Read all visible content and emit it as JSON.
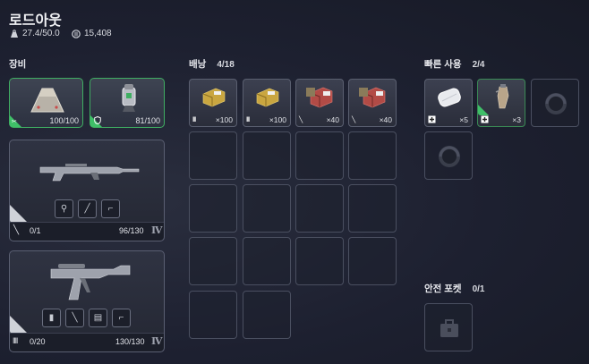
{
  "header": {
    "title": "로드아웃",
    "weight": "27.4/50.0",
    "currency": "15,408"
  },
  "equipment": {
    "label": "장비",
    "augment": {
      "value": "100/100"
    },
    "shield": {
      "value": "81/100"
    }
  },
  "weapons": [
    {
      "ammo": "0/1",
      "durability": "96/130",
      "tier": "Ⅳ",
      "attachments": [
        "scope-icon",
        "muzzle-icon",
        "stock-icon"
      ]
    },
    {
      "ammo": "0/20",
      "durability": "130/130",
      "tier": "Ⅳ",
      "attachments": [
        "grip-icon",
        "barrel-icon",
        "magazine-icon",
        "stock-icon"
      ]
    }
  ],
  "backpack": {
    "label": "배낭",
    "count": "4/18",
    "items": [
      {
        "icon": "light-ammo-icon",
        "qty": "×100"
      },
      {
        "icon": "light-ammo-icon",
        "qty": "×100"
      },
      {
        "icon": "shotgun-ammo-icon",
        "qty": "×40"
      },
      {
        "icon": "shotgun-ammo-icon",
        "qty": "×40"
      }
    ]
  },
  "quick_use": {
    "label": "빠른 사용",
    "count": "2/4",
    "items": [
      {
        "icon": "bandage-icon",
        "qty": "×5"
      },
      {
        "icon": "grenade-icon",
        "qty": "×3"
      }
    ]
  },
  "safe_pocket": {
    "label": "안전 포켓",
    "count": "0/1"
  },
  "colors": {
    "rarity_green": "#3fae62",
    "common": "#d6d8de"
  }
}
